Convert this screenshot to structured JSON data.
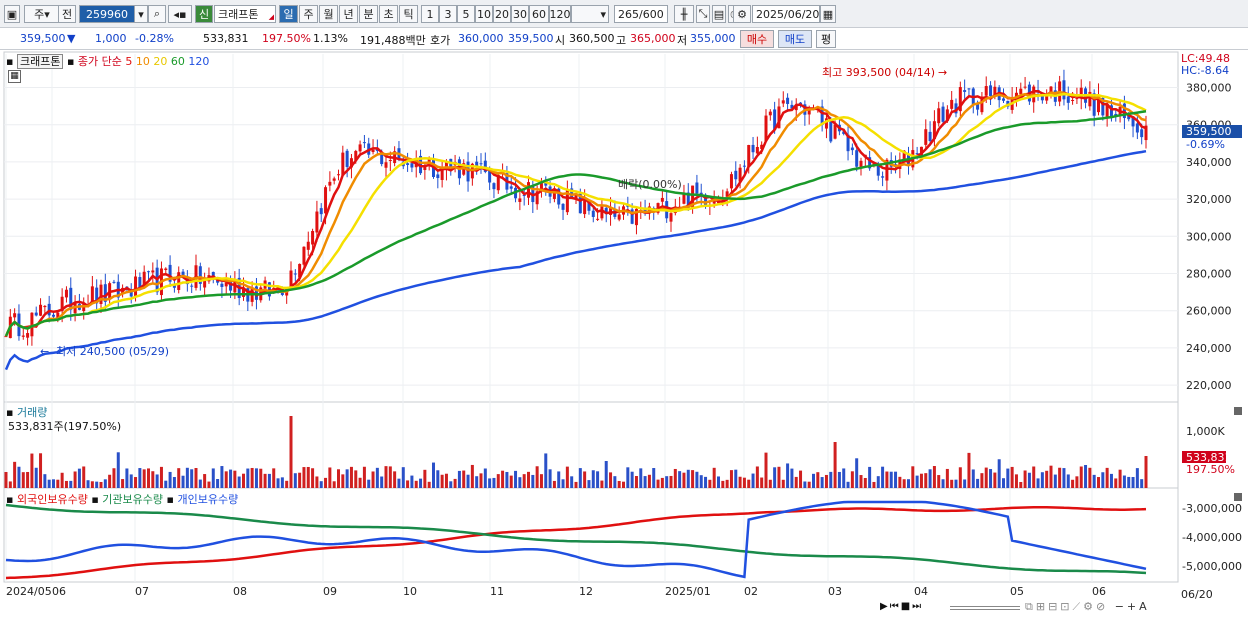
{
  "toolbar": {
    "menu_icon": "window-menu-icon",
    "market": "주",
    "prev_label": "전",
    "code": "259960",
    "search_icon": "search-icon",
    "sound_icon": "speaker-icon",
    "new_badge": "신",
    "stock_name": "크래프톤",
    "periods": [
      "일",
      "주",
      "월",
      "년",
      "분",
      "초",
      "틱"
    ],
    "active_period": "일",
    "intervals": [
      "1",
      "3",
      "5",
      "10",
      "20",
      "30",
      "60",
      "120"
    ],
    "count": "265",
    "count_total": "/600",
    "date": "2025/06/20"
  },
  "quote": {
    "price": "359,500",
    "change": "1,000",
    "change_pct": "-0.28%",
    "volume": "533,831",
    "volume_ratio": "197.50%",
    "turnover_pct": "1.13%",
    "amount": "191,488백만",
    "ask_label": "호가",
    "ask": "360,000",
    "bid": "359,500",
    "open_label": "시",
    "open": "360,500",
    "high_label": "고",
    "high": "365,000",
    "low_label": "저",
    "low": "355,000",
    "buy_btn": "매수",
    "sell_btn": "매도",
    "eval_btn": "평"
  },
  "price_panel": {
    "title": "크래프톤",
    "series_label": "종가 단순",
    "ma": [
      "5",
      "10",
      "20",
      "60",
      "120"
    ],
    "ma_colors": [
      "#e01010",
      "#f08c00",
      "#f5e000",
      "#1a9a2a",
      "#2050e0"
    ],
    "lc": "LC:49.48",
    "hc": "HC:-8.64",
    "high_note": "최고 393,500 (04/14)",
    "low_note": "최저 240,500 (05/29)",
    "mid_note": "배락(0.00%)",
    "last_price": "359,500",
    "last_pct": "-0.69%",
    "y_ticks": [
      "380,000",
      "360,000",
      "340,000",
      "320,000",
      "300,000",
      "280,000",
      "260,000",
      "240,000",
      "220,000"
    ]
  },
  "volume_panel": {
    "title": "거래량",
    "value": "533,831주(197.50%)",
    "y_tick": "1,000K",
    "last_value": "533,831",
    "last_pct": "197.50%"
  },
  "holding_panel": {
    "series": [
      "외국인보유수량",
      "기관보유수량",
      "개인보유수량"
    ],
    "colors": [
      "#e01010",
      "#1a8a4a",
      "#2050e0"
    ],
    "y_ticks": [
      "-3,000,000",
      "-4,000,000",
      "-5,000,000"
    ]
  },
  "x_axis": [
    "2024/05",
    "06",
    "07",
    "08",
    "09",
    "10",
    "11",
    "12",
    "2025/01",
    "02",
    "03",
    "04",
    "05",
    "06"
  ],
  "x_last": "06/20",
  "chart_data": {
    "type": "candlestick",
    "ylim": [
      212000,
      398000
    ],
    "high": 393500,
    "low": 240500,
    "last": 359500,
    "close_path_months": [
      "2024/05",
      "06",
      "07",
      "08",
      "09",
      "10",
      "11",
      "12",
      "2025/01",
      "02",
      "03",
      "04",
      "05",
      "06"
    ],
    "close_approx": [
      252000,
      268000,
      278000,
      270000,
      344000,
      338000,
      325000,
      310000,
      322000,
      370000,
      335000,
      375000,
      378000,
      359500
    ]
  }
}
